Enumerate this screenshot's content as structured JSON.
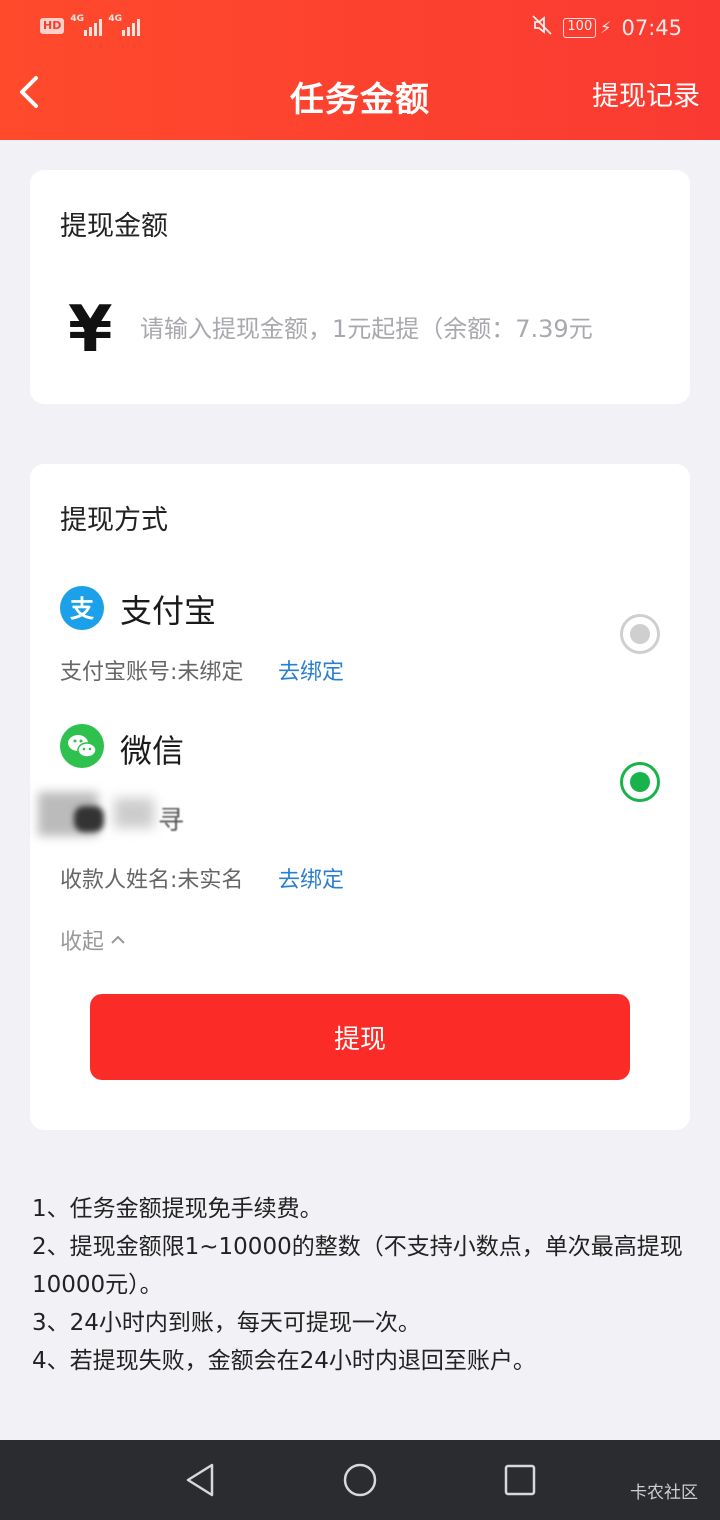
{
  "status_bar": {
    "hd": "HD",
    "sim1": "4G",
    "sim2": "4G",
    "battery": "100",
    "time": "07:45"
  },
  "header": {
    "title": "任务金额",
    "records_link": "提现记录",
    "background": "#fa3a32"
  },
  "amount_card": {
    "title": "提现金额",
    "currency_symbol": "¥",
    "input_value": "",
    "input_placeholder": "请输入提现金额，1元起提（余额：7.39元"
  },
  "method_card": {
    "title": "提现方式",
    "methods": [
      {
        "name": "支付宝",
        "icon": "alipay-icon",
        "icon_color": "#1ba0e9",
        "account_text": "支付宝账号:未绑定",
        "bind_label": "去绑定",
        "selected": false
      },
      {
        "name": "微信",
        "icon": "wechat-icon",
        "icon_color": "#2ec14e",
        "masked_name_fragment": "寻",
        "account_text": "收款人姓名:未实名",
        "bind_label": "去绑定",
        "selected": true
      }
    ],
    "collapse_label": "收起",
    "withdraw_button": "提现",
    "button_color": "#fb2b27"
  },
  "notes": [
    "1、任务金额提现免手续费。",
    "2、提现金额限1~10000的整数（不支持小数点，单次最高提现10000元）。",
    "3、24小时内到账，每天可提现一次。",
    "4、若提现失败，金额会在24小时内退回至账户。"
  ],
  "system_nav": {
    "watermark": "卡农社区"
  }
}
